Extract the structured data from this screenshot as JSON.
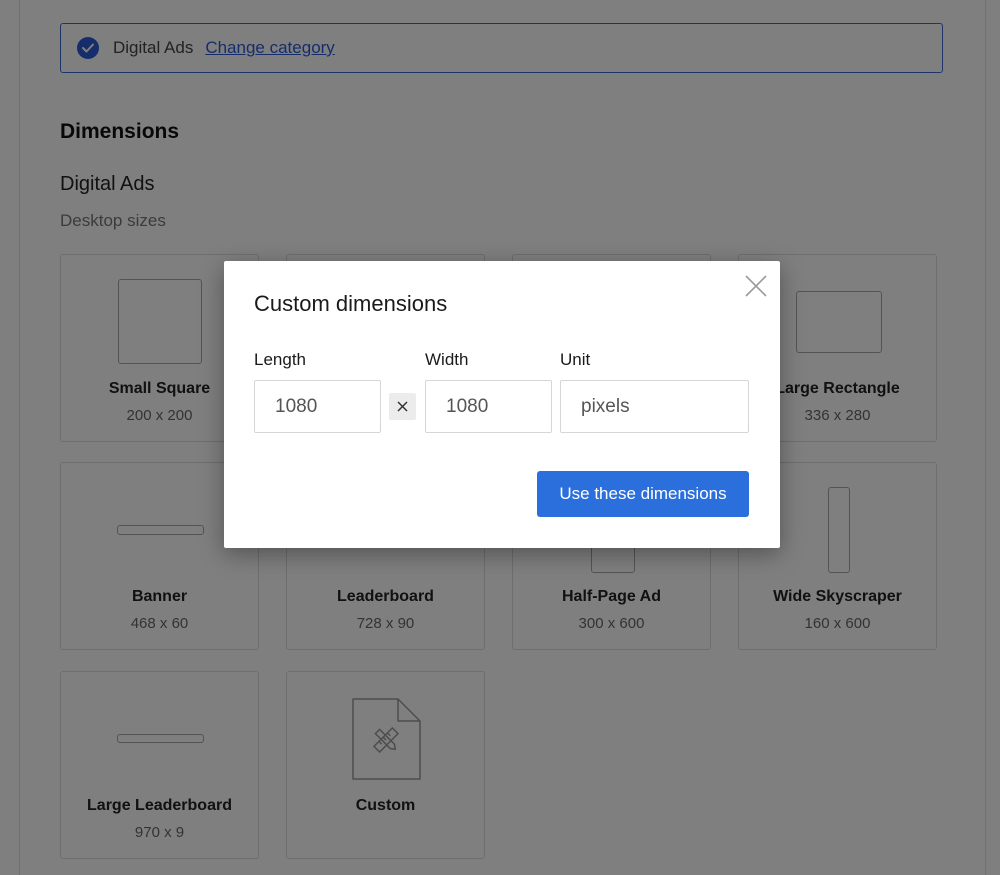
{
  "category": {
    "name": "Digital Ads",
    "change_link": "Change category"
  },
  "page": {
    "section_title": "Dimensions",
    "sub_title": "Digital Ads",
    "group_label": "Desktop sizes"
  },
  "cards": [
    {
      "name": "Small Square",
      "size": "200 x 200"
    },
    {
      "name": "",
      "size": ""
    },
    {
      "name": "",
      "size": ""
    },
    {
      "name": "Large Rectangle",
      "size": "336 x 280"
    },
    {
      "name": "Banner",
      "size": "468 x 60"
    },
    {
      "name": "Leaderboard",
      "size": "728 x 90"
    },
    {
      "name": "Half-Page Ad",
      "size": "300 x 600"
    },
    {
      "name": "Wide Skyscraper",
      "size": "160 x 600"
    },
    {
      "name": "Large Leaderboard",
      "size": "970 x 9"
    },
    {
      "name": "Custom",
      "size": ""
    }
  ],
  "modal": {
    "title": "Custom dimensions",
    "length_label": "Length",
    "width_label": "Width",
    "unit_label": "Unit",
    "length_value": "1080",
    "width_value": "1080",
    "unit_value": "pixels",
    "submit_label": "Use these dimensions"
  },
  "colors": {
    "accent": "#2a6fdb",
    "link": "#2a5bd7",
    "overlay": "rgba(0,0,0,0.5)"
  },
  "icons": [
    "check-circle-icon",
    "times-icon",
    "close-icon",
    "custom-file-icon"
  ]
}
